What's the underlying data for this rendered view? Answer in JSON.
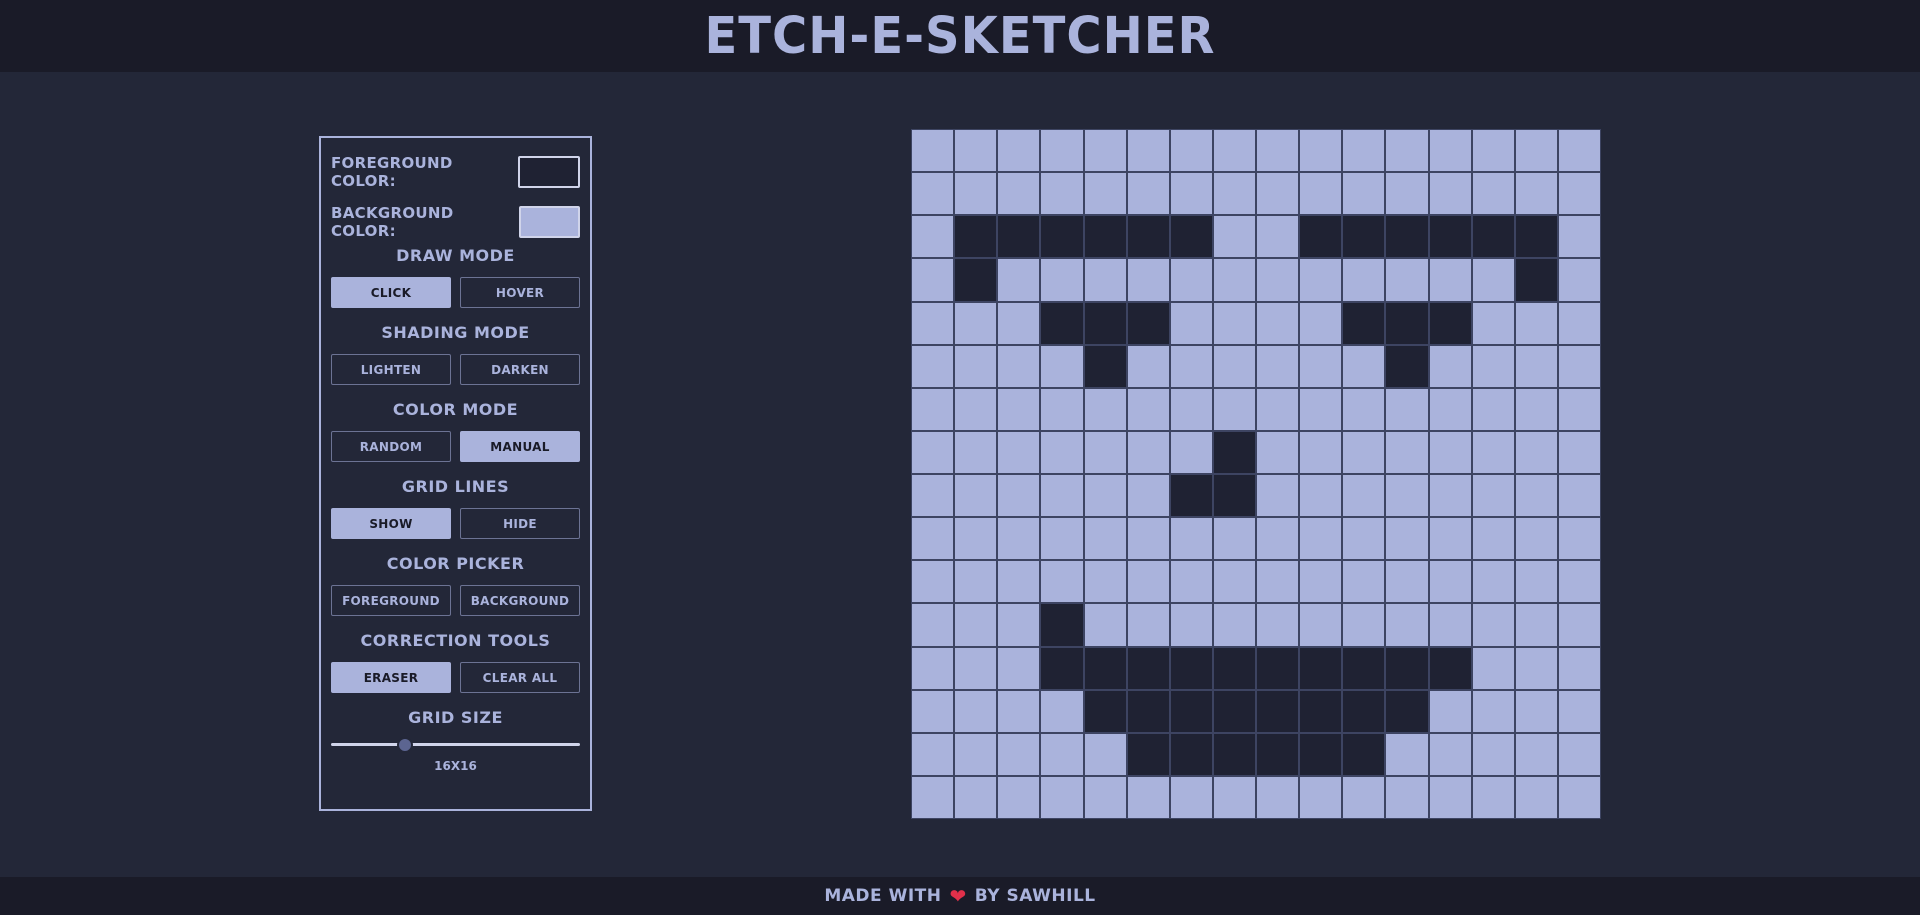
{
  "header": {
    "title": "ETCH-E-SKETCHER"
  },
  "controls": {
    "foreground_label": "FOREGROUND COLOR:",
    "background_label": "BACKGROUND COLOR:",
    "foreground_color": "#1f2233",
    "background_color": "#aab3dc",
    "draw_mode": {
      "title": "DRAW MODE",
      "click": "CLICK",
      "hover": "HOVER",
      "active": "click"
    },
    "shading_mode": {
      "title": "SHADING MODE",
      "lighten": "LIGHTEN",
      "darken": "DARKEN"
    },
    "color_mode": {
      "title": "COLOR MODE",
      "random": "RANDOM",
      "manual": "MANUAL",
      "active": "manual"
    },
    "grid_lines": {
      "title": "GRID LINES",
      "show": "SHOW",
      "hide": "HIDE",
      "active": "show"
    },
    "color_picker": {
      "title": "COLOR PICKER",
      "foreground": "FOREGROUND",
      "background": "BACKGROUND"
    },
    "correction_tools": {
      "title": "CORRECTION TOOLS",
      "eraser": "ERASER",
      "clear_all": "CLEAR ALL",
      "active": "eraser"
    },
    "grid_size": {
      "title": "GRID SIZE",
      "value_label": "16X16",
      "value": 16
    }
  },
  "canvas": {
    "size": 16,
    "dark_color": "#1f2233",
    "light_color": "#aab3dc",
    "rows": [
      "0000000000000000",
      "0000000000000000",
      "0111111001111110",
      "0100000000000010",
      "0001110000111000",
      "0000100000010000",
      "0000000000000000",
      "0000000100000000",
      "0000001100000000",
      "0000000000000000",
      "0000000000000000",
      "0001000000000000",
      "0001111111111000",
      "0000111111110000",
      "0000011111100000",
      "0000000000000000"
    ]
  },
  "footer": {
    "made_with": "MADE WITH",
    "by": "BY SAWHILL",
    "heart_icon": "heart-icon"
  }
}
